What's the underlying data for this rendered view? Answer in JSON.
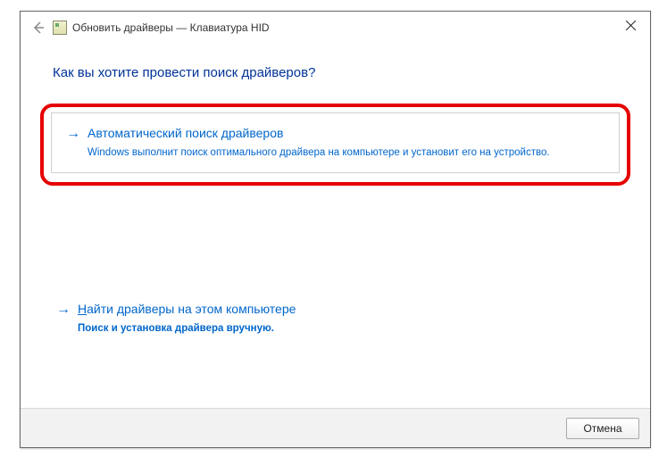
{
  "titlebar": {
    "text": "Обновить драйверы — Клавиатура HID"
  },
  "heading": "Как вы хотите провести поиск драйверов?",
  "option1": {
    "title": "Автоматический поиск драйверов",
    "desc": "Windows выполнит поиск оптимального драйвера на компьютере и установит его на устройство."
  },
  "option2": {
    "title_prefix": "Н",
    "title_rest": "айти драйверы на этом компьютере",
    "desc": "Поиск и установка драйвера вручную."
  },
  "footer": {
    "cancel": "Отмена"
  }
}
